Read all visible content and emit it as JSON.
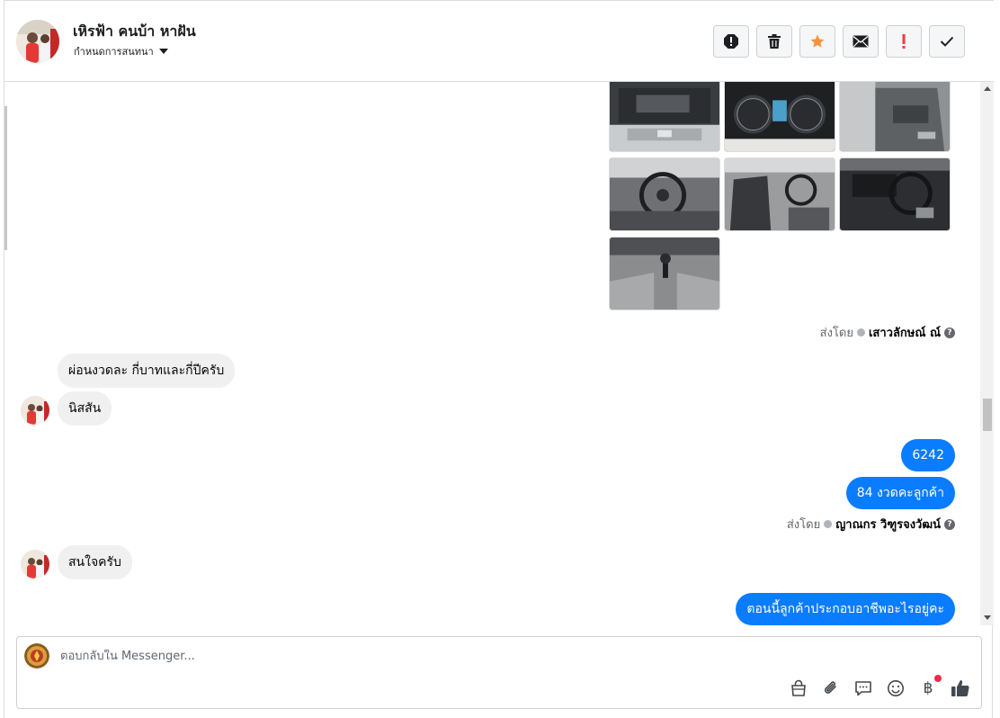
{
  "header": {
    "contact_name": "เหิรฟ้า คนบ้า หาฝัน",
    "subtitle": "กำหนดการสนทนา",
    "actions": [
      {
        "name": "report-icon"
      },
      {
        "name": "trash-icon"
      },
      {
        "name": "star-icon",
        "color": "#f7923b"
      },
      {
        "name": "mail-icon"
      },
      {
        "name": "exclamation-icon",
        "color": "#fa383e"
      },
      {
        "name": "check-icon"
      }
    ]
  },
  "conversation": {
    "photos_sent_by": {
      "prefix": "ส่งโดย",
      "name": "เสาวลักษณ์ ณ์"
    },
    "incoming_1": [
      "ผ่อนงวดละ กี่บาทและกี่ปีครับ",
      "นิสสัน"
    ],
    "outgoing_1": [
      "6242",
      "84 งวดคะลูกค้า"
    ],
    "outgoing_1_sent_by": {
      "prefix": "ส่งโดย",
      "name": "ญาณกร วิฑูรจงวัฒน์"
    },
    "incoming_2": [
      "สนใจครับ"
    ],
    "outgoing_2": [
      "ตอนนี้ลูกค้าประกอบอาชีพอะไรอยู่คะ"
    ]
  },
  "composer": {
    "placeholder": "ตอบกลับใน Messenger...",
    "tools": [
      "shopping-bag-icon",
      "paperclip-icon",
      "chat-bubble-icon",
      "emoji-icon",
      "baht-icon",
      "thumbs-up-icon"
    ],
    "baht_symbol": "฿"
  },
  "colors": {
    "outgoing_bubble": "#0a7cff",
    "incoming_bubble": "#f0f0f0",
    "notification_dot": "#f02849"
  }
}
